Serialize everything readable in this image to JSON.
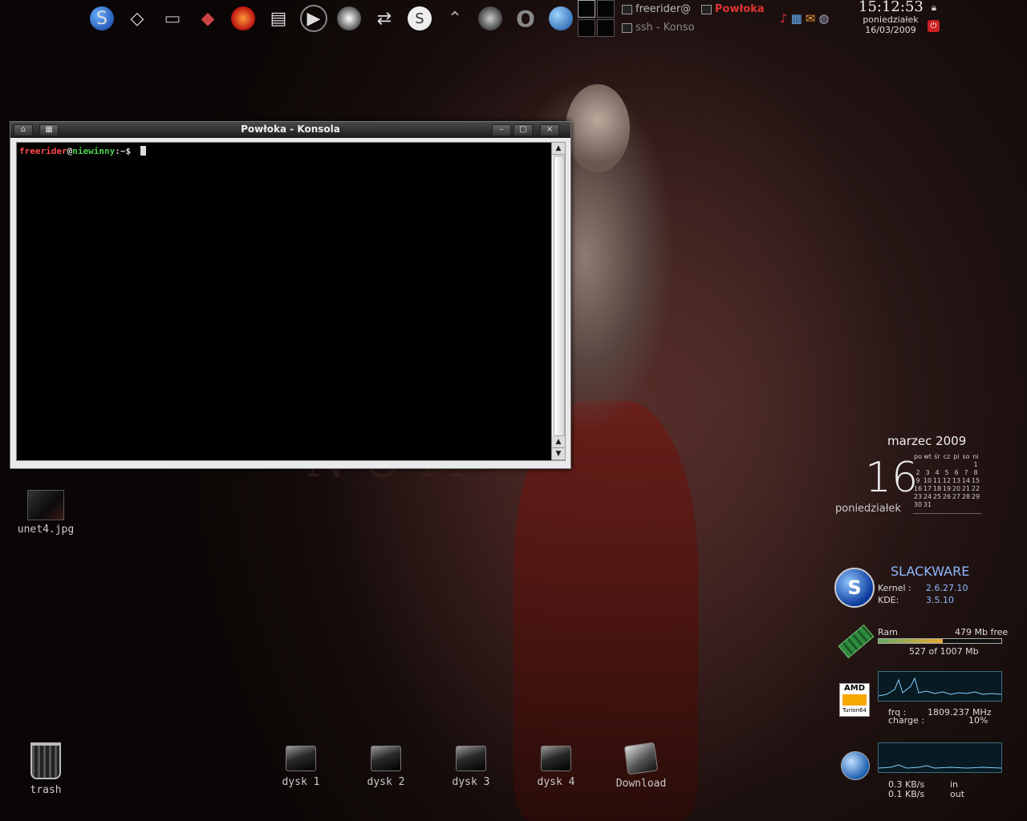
{
  "wallpaper": {
    "text": "NOM"
  },
  "panel": {
    "launchers": [
      {
        "icon": "slackware-icon",
        "glyph": "S"
      },
      {
        "icon": "eraser-icon",
        "glyph": "◇"
      },
      {
        "icon": "terminal-icon",
        "glyph": "▭"
      },
      {
        "icon": "game-icon",
        "glyph": "◆"
      },
      {
        "icon": "firefox-icon",
        "glyph": "●"
      },
      {
        "icon": "video-editor-icon",
        "glyph": "▤"
      },
      {
        "icon": "media-player-icon",
        "glyph": "▶"
      },
      {
        "icon": "wolf-icon",
        "glyph": "●"
      },
      {
        "icon": "sync-icon",
        "glyph": "⇄"
      },
      {
        "icon": "skype-icon",
        "glyph": "S"
      },
      {
        "icon": "blade-icon",
        "glyph": "⌃"
      },
      {
        "icon": "gimp-icon",
        "glyph": "●"
      },
      {
        "icon": "opera-icon",
        "glyph": "O"
      },
      {
        "icon": "browser-globe-icon",
        "glyph": "◉"
      }
    ],
    "tasks": [
      {
        "label": "freerider@"
      },
      {
        "label": "Powłoka"
      },
      {
        "label": "ssh - Konso"
      }
    ],
    "clock": {
      "time": "15:12:53",
      "day": "poniedziałek",
      "date": "16/03/2009"
    }
  },
  "konsole": {
    "title": "Powłoka - Konsola",
    "prompt_user": "freerider",
    "prompt_at": "@",
    "prompt_host": "niewinny",
    "prompt_tail": ":~$",
    "buttons": {
      "minimize": "–",
      "maximize": "□",
      "close": "×"
    }
  },
  "desktop_icons": [
    {
      "label": "unet4.jpg"
    },
    {
      "label": "trash"
    },
    {
      "label": "dysk 1"
    },
    {
      "label": "dysk 2"
    },
    {
      "label": "dysk 3"
    },
    {
      "label": "dysk 4"
    },
    {
      "label": "Download"
    }
  ],
  "calendar": {
    "month": "marzec 2009",
    "day_number": "16",
    "day_name": "poniedziałek",
    "headers": [
      "po",
      "wt",
      "śr",
      "cz",
      "pi",
      "so",
      "ni"
    ],
    "weeks": [
      [
        "",
        "",
        "",
        "",
        "",
        "",
        "1"
      ],
      [
        "2",
        "3",
        "4",
        "5",
        "6",
        "7",
        "8"
      ],
      [
        "9",
        "10",
        "11",
        "12",
        "13",
        "14",
        "15"
      ],
      [
        "16",
        "17",
        "18",
        "19",
        "20",
        "21",
        "22"
      ],
      [
        "23",
        "24",
        "25",
        "26",
        "27",
        "28",
        "29"
      ],
      [
        "30",
        "31",
        "",
        "",
        "",
        "",
        ""
      ]
    ]
  },
  "sysinfo": {
    "distro": "SLACKWARE",
    "kernel_label": "Kernel :",
    "kernel": "2.6.27.10",
    "kde_label": "KDE:",
    "kde": "3.5.10",
    "ram_label": "Ram",
    "ram_free": "479 Mb free",
    "ram_used": "527 of 1007 Mb",
    "ram_fraction": 0.52,
    "cpu_brand": "AMD",
    "cpu_model": "Turion64",
    "frq_label": "frq :",
    "frq": "1809.237 MHz",
    "charge_label": "charge :",
    "charge": "10%",
    "net_in": "0.3 KB/s",
    "net_in_label": "in",
    "net_out": "0.1 KB/s",
    "net_out_label": "out"
  }
}
